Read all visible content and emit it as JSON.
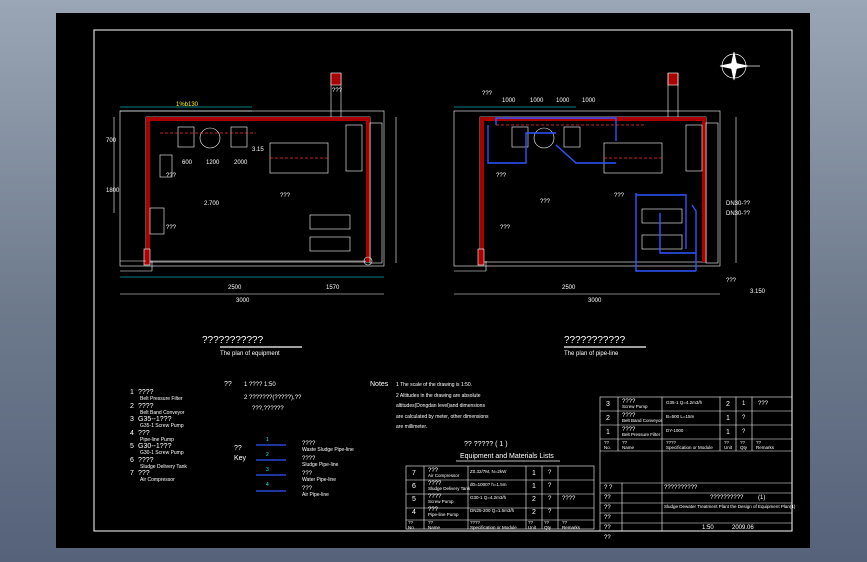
{
  "left_plan": {
    "title": "???????????",
    "subtitle": "The plan of equipment",
    "dims_top": [
      "1%b130"
    ],
    "dims_bottom": [
      "2500",
      "1570",
      "3000"
    ],
    "dims_left": [
      "700",
      "1800"
    ],
    "dims_mid": [
      "600",
      "1200",
      "2000"
    ],
    "tags": [
      "???",
      "???",
      "???",
      "3.15",
      "???",
      "2.700"
    ]
  },
  "right_plan": {
    "title": "???????????",
    "subtitle": "The plan of pipe-line",
    "dims_top": [
      "???",
      "1000",
      "1000",
      "1000",
      "1000"
    ],
    "dims_bottom": [
      "2500",
      "3000"
    ],
    "tags": [
      "???",
      "???",
      "???",
      "???",
      "DN30-??",
      "DN30-??",
      "???",
      "3.150"
    ]
  },
  "legend": {
    "items": [
      {
        "num": "1",
        "name": "????",
        "en": "Belt Pressure Filter"
      },
      {
        "num": "2",
        "name": "????",
        "en": "Belt Band Conveyor"
      },
      {
        "num": "3",
        "name": "G35--1???",
        "en": "G35-1 Screw Pump"
      },
      {
        "num": "4",
        "name": "???",
        "en": "Pipe-line Pump"
      },
      {
        "num": "5",
        "name": "G30--1???",
        "en": "G30-1 Screw Pump"
      },
      {
        "num": "6",
        "name": "????",
        "en": "Sludge Delivery Tank"
      },
      {
        "num": "7",
        "name": "???",
        "en": "Air Compressor"
      }
    ],
    "scale_header": "??",
    "scale_items": [
      "1  ????   1:50",
      "2  ???????(?????),??",
      "???,??????"
    ],
    "key_header": "??",
    "key_sub": "Key",
    "key_items": [
      {
        "sym": "1",
        "cn": "????",
        "en": "Waste Sludge Pipe-line"
      },
      {
        "sym": "2",
        "cn": "????",
        "en": "Sludge Pipe-line"
      },
      {
        "sym": "3",
        "cn": "???",
        "en": "Water Pipe-line"
      },
      {
        "sym": "4",
        "cn": "???",
        "en": "Air Pipe-line"
      }
    ]
  },
  "notes": {
    "title": "Notes",
    "lines": [
      "1  The scale of the drawing is 1:50.",
      "2  Altitudes in the drawing are absolute",
      "    altitudes(Dongdan level)and dimensions",
      "    are calculated by meter, other dimensions",
      "    are millimeter."
    ]
  },
  "table": {
    "title_cn": "??   ?????          ( 1 )",
    "title_en": "Equipment and Materials Lists",
    "rows": [
      {
        "no": "7",
        "name": "???",
        "name_en": "Air Compressor",
        "spec": "Z0.32/7M, N=2kW",
        "unit": "1",
        "qty": "?",
        "rem": ""
      },
      {
        "no": "6",
        "name": "????",
        "name_en": "Sludge Delivery Tank",
        "spec": "d0=1000?   h=1.5m",
        "unit": "1",
        "qty": "?",
        "rem": ""
      },
      {
        "no": "5",
        "name": "????",
        "name_en": "Screw Pump",
        "spec": "G30-1 Q=4.2m3/h",
        "unit": "2",
        "qty": "?",
        "rem": "????"
      },
      {
        "no": "4",
        "name": "???",
        "name_en": "Pipe-line Pump",
        "spec": "DN25-200  Q=1.5m3/h",
        "unit": "2",
        "qty": "?",
        "rem": ""
      }
    ],
    "header": [
      "??\nNo.",
      "??\nName",
      "????\nSpecification or Module",
      "??\nUnit",
      "??\nQty",
      "??\nRemarks"
    ]
  },
  "table2": {
    "rows": [
      {
        "no": "3",
        "name": "????",
        "name_en": "Screw Pump",
        "spec": "G35-1 Q=4.2m3/h",
        "unit": "2",
        "qty": "1",
        "rem": "???"
      },
      {
        "no": "2",
        "name": "????",
        "name_en": "Belt Band Conveyor",
        "spec": "B=500  L=15m",
        "unit": "1",
        "qty": "?",
        "rem": ""
      },
      {
        "no": "1",
        "name": "????",
        "name_en": "Belt Pressure Filter",
        "spec": "DY-1000",
        "unit": "1",
        "qty": "?",
        "rem": ""
      }
    ],
    "header": [
      "??\nNo.",
      "??\nName",
      "????\nSpecification or Module",
      "??\nUnit",
      "??\nQty",
      "??\nRemarks"
    ]
  },
  "titleblock": {
    "proj_label": "? ?",
    "proj_val": "??????????",
    "drawing_cn": "??????????",
    "drawing_num": "(1)",
    "drawing_en": "Sludge Dewater Treatment Plant    the Design of Equipment Plan(1)",
    "scale": "1:50",
    "date": "2009.06",
    "rows": [
      "??",
      "??",
      "??",
      "??",
      "??"
    ]
  }
}
